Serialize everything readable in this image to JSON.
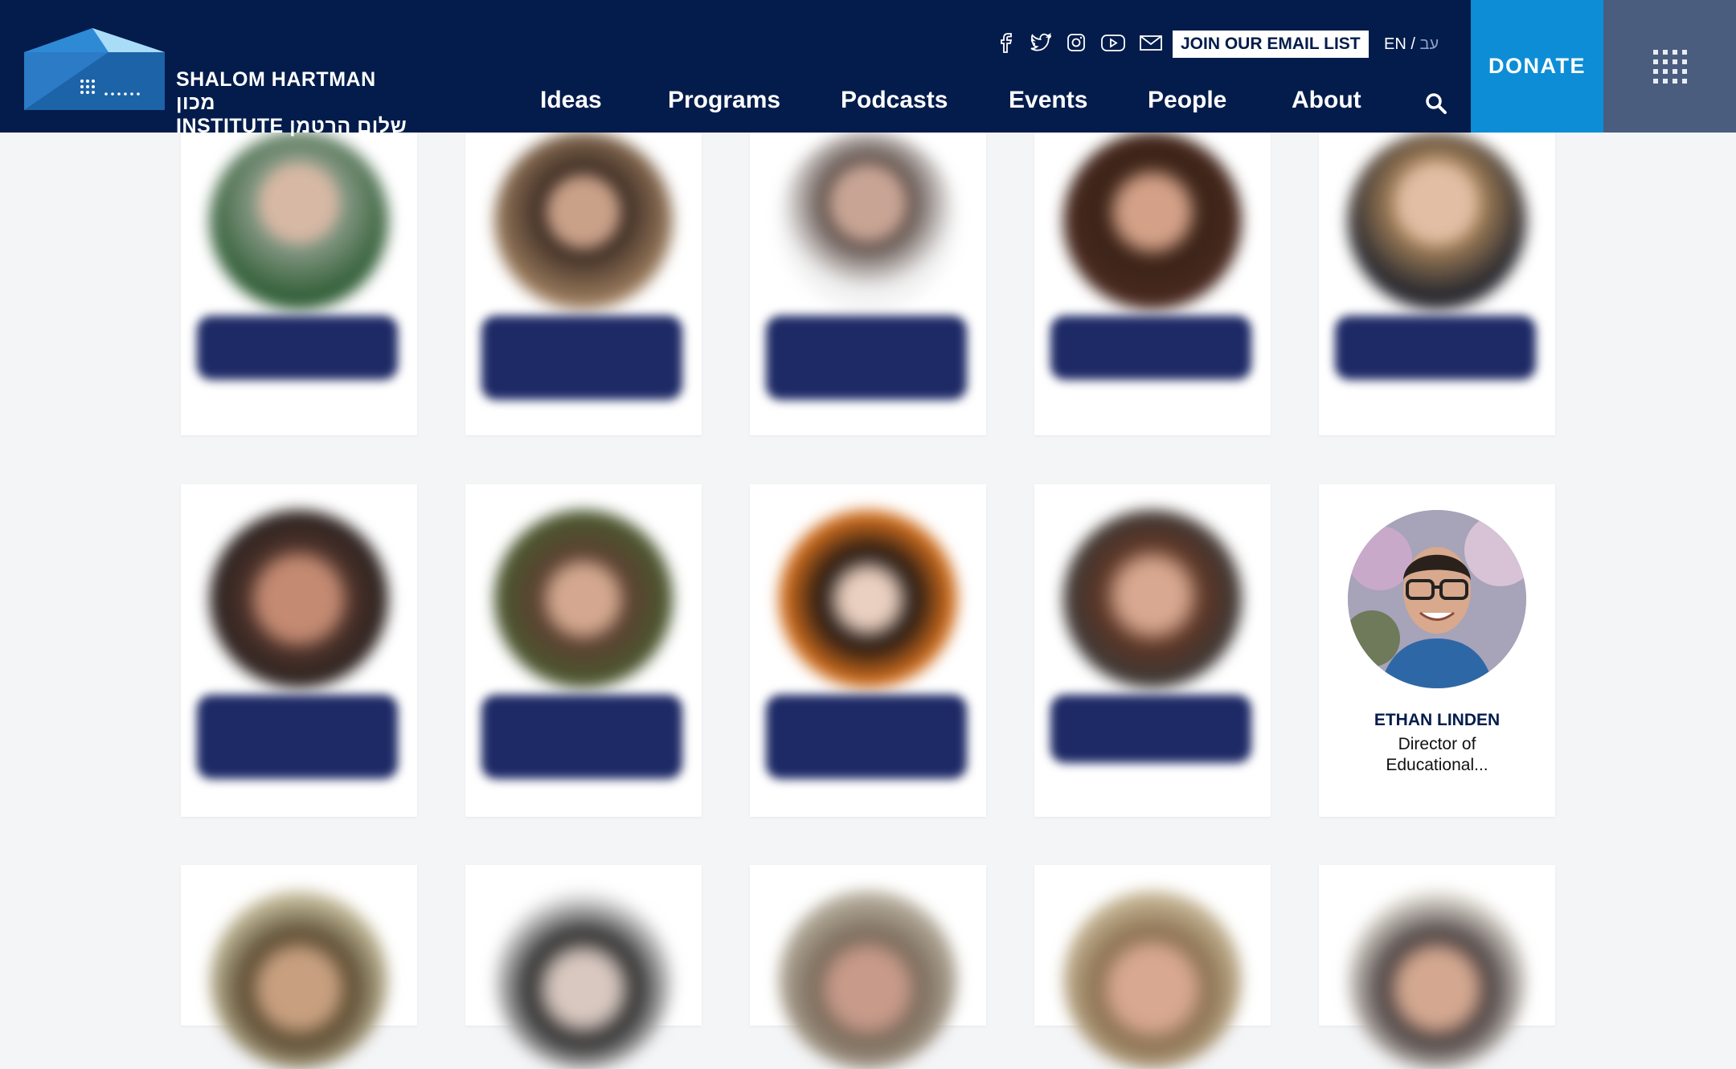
{
  "header": {
    "logo_line1": "SHALOM HARTMAN מכון",
    "logo_line2": "INSTITUTE שלום הרטמן",
    "join_label": "JOIN OUR EMAIL LIST",
    "lang_en": "EN",
    "lang_sep": "/",
    "lang_he": "עב",
    "donate_label": "DONATE",
    "social_icons": [
      "facebook-icon",
      "twitter-icon",
      "instagram-icon",
      "youtube-icon",
      "mail-icon"
    ],
    "nav": [
      {
        "label": "Ideas"
      },
      {
        "label": "Programs"
      },
      {
        "label": "Podcasts"
      },
      {
        "label": "Events"
      },
      {
        "label": "People"
      },
      {
        "label": "About"
      }
    ]
  },
  "people": {
    "featured": {
      "name": "ETHAN LINDEN",
      "title_line1": "Director of",
      "title_line2": "Educational..."
    }
  },
  "colors": {
    "header_bg": "#031c4b",
    "donate_bg": "#0d8dd6",
    "menu_bg": "#4a5d7f",
    "page_bg": "#f4f5f7",
    "name_block": "#1e2a66"
  }
}
